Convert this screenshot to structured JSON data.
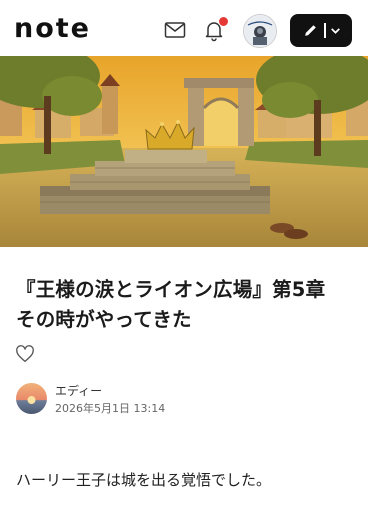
{
  "header": {
    "logo": "note",
    "icons": [
      "mail-icon",
      "bell-icon",
      "pencil-icon",
      "chevron-down-icon"
    ],
    "notification_dot_color": "#e53935"
  },
  "hero": {
    "image": "golden-crown-on-stone-steps-in-square-with-arch-at-sunset"
  },
  "article": {
    "title": "『王様の涙とライオン広場』第5章　その時がやってきた",
    "author": "エディー",
    "date": "2026年5月1日 13:14",
    "body_first_line": "ハーリー王子は城を出る覚悟でした。"
  },
  "colors": {
    "accent": "#111111",
    "text": "#222222",
    "muted": "#666666"
  }
}
